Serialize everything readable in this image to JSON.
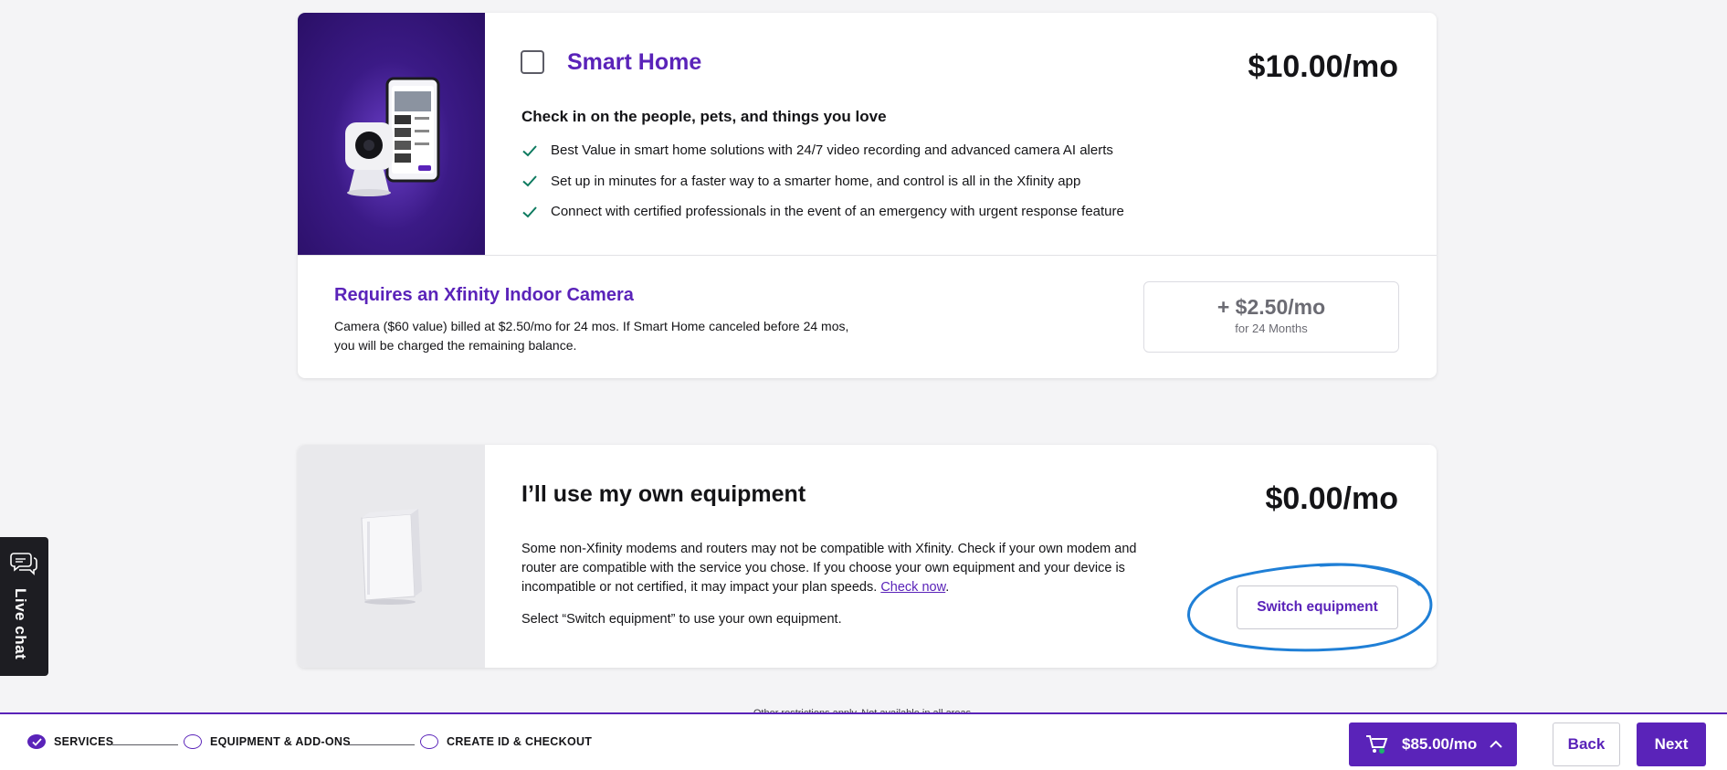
{
  "smart_home": {
    "title": "Smart Home",
    "price": "$10.00/mo",
    "subheading": "Check in on the people, pets, and things you love",
    "features": [
      "Best Value in smart home solutions with 24/7 video recording and advanced camera AI alerts",
      "Set up in minutes for a faster way to a smarter home, and control is all in the Xfinity app",
      "Connect with certified professionals in the event of an emergency with urgent response feature"
    ],
    "requirement_title": "Requires an Xfinity Indoor Camera",
    "requirement_desc": "Camera ($60 value) billed at $2.50/mo for 24 mos. If Smart Home canceled before 24 mos, you will be charged the remaining balance.",
    "addon_price": "+ $2.50/mo",
    "addon_term": "for 24 Months",
    "checked": false
  },
  "own_equipment": {
    "title": "I’ll use my own equipment",
    "price": "$0.00/mo",
    "desc": "Some non-Xfinity modems and routers may not be compatible with Xfinity. Check if your own modem and router are compatible with the service you chose. If you choose your own equipment and your device is incompatible or not certified, it may impact your plan speeds. ",
    "check_link": "Check now",
    "desc_end": ".",
    "note": "Select “Switch equipment” to use your own equipment.",
    "switch_label": "Switch equipment"
  },
  "footnote": "Other restrictions apply. Not available in all areas.",
  "live_chat": {
    "label": "Live chat"
  },
  "footer": {
    "steps": [
      {
        "label": "SERVICES",
        "done": true
      },
      {
        "label": "EQUIPMENT & ADD-ONS",
        "done": false
      },
      {
        "label": "CREATE ID & CHECKOUT",
        "done": false
      }
    ],
    "cart_total": "$85.00/mo",
    "back_label": "Back",
    "next_label": "Next"
  },
  "colors": {
    "brand_purple": "#5a23b9",
    "check_green": "#0d7a5f",
    "annotation_blue": "#1f7fd6"
  },
  "icons": [
    "smart-home-product-image",
    "modem-product-image",
    "checkmark-icon",
    "chat-bubbles-icon",
    "cart-icon",
    "chevron-up-icon",
    "check-circle-icon"
  ]
}
